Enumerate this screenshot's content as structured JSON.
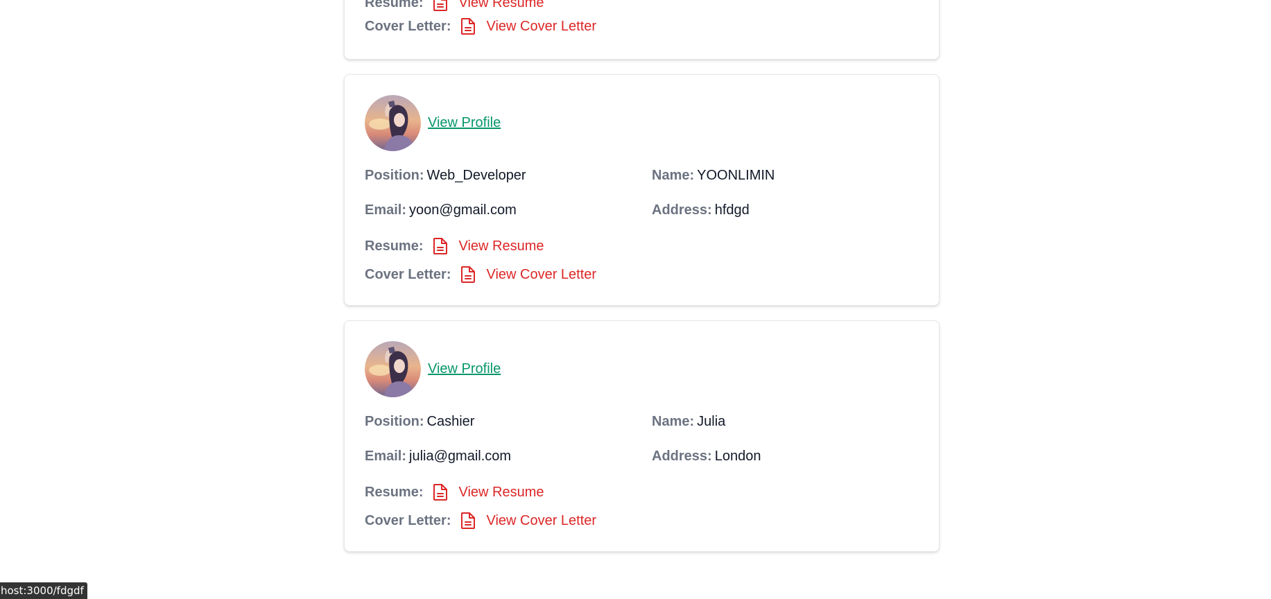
{
  "applicants": [
    {
      "resume_label": "Resume:",
      "resume_link": "View Resume",
      "cover_label": "Cover Letter:",
      "cover_link": "View Cover Letter"
    },
    {
      "profile_link": "View Profile",
      "position_label": "Position:",
      "position": "Web_Developer",
      "name_label": "Name:",
      "name": "YOONLIMIN",
      "email_label": "Email:",
      "email": "yoon@gmail.com",
      "address_label": "Address:",
      "address": "hfdgd",
      "resume_label": "Resume:",
      "resume_link": "View Resume",
      "cover_label": "Cover Letter:",
      "cover_link": "View Cover Letter"
    },
    {
      "profile_link": "View Profile",
      "position_label": "Position:",
      "position": "Cashier",
      "name_label": "Name:",
      "name": "Julia",
      "email_label": "Email:",
      "email": "julia@gmail.com",
      "address_label": "Address:",
      "address": "London",
      "resume_label": "Resume:",
      "resume_link": "View Resume",
      "cover_label": "Cover Letter:",
      "cover_link": "View Cover Letter"
    }
  ],
  "status_bar": {
    "url": "host:3000/fdgdf"
  },
  "colors": {
    "label": "#6b7280",
    "link_green": "#059669",
    "link_red": "#dc2626"
  },
  "icons": {
    "document": "file-text-icon",
    "avatar": "avatar"
  }
}
